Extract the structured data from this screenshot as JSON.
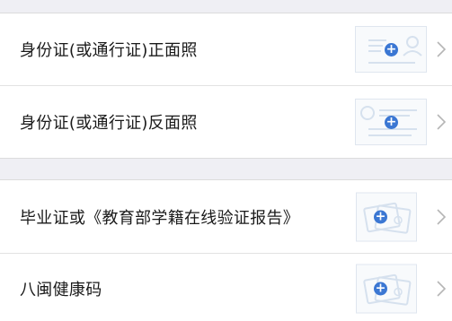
{
  "sections": [
    {
      "rows": [
        {
          "label": "身份证(或通行证)正面照",
          "thumb_icon": "id-card-front-icon",
          "action_icon": "add-photo-icon",
          "nav_icon": "chevron-right-icon"
        },
        {
          "label": "身份证(或通行证)反面照",
          "thumb_icon": "id-card-back-icon",
          "action_icon": "add-photo-icon",
          "nav_icon": "chevron-right-icon"
        }
      ]
    },
    {
      "rows": [
        {
          "label": "毕业证或《教育部学籍在线验证报告》",
          "thumb_icon": "document-photo-icon",
          "action_icon": "add-photo-icon",
          "nav_icon": "chevron-right-icon"
        },
        {
          "label": "八闽健康码",
          "thumb_icon": "document-photo-icon",
          "action_icon": "add-photo-icon",
          "nav_icon": "chevron-right-icon"
        }
      ]
    }
  ],
  "colors": {
    "accent": "#3b77d3",
    "placeholder_line": "#d6e1ee",
    "background": "#efeff4"
  },
  "plus_glyph": "+"
}
